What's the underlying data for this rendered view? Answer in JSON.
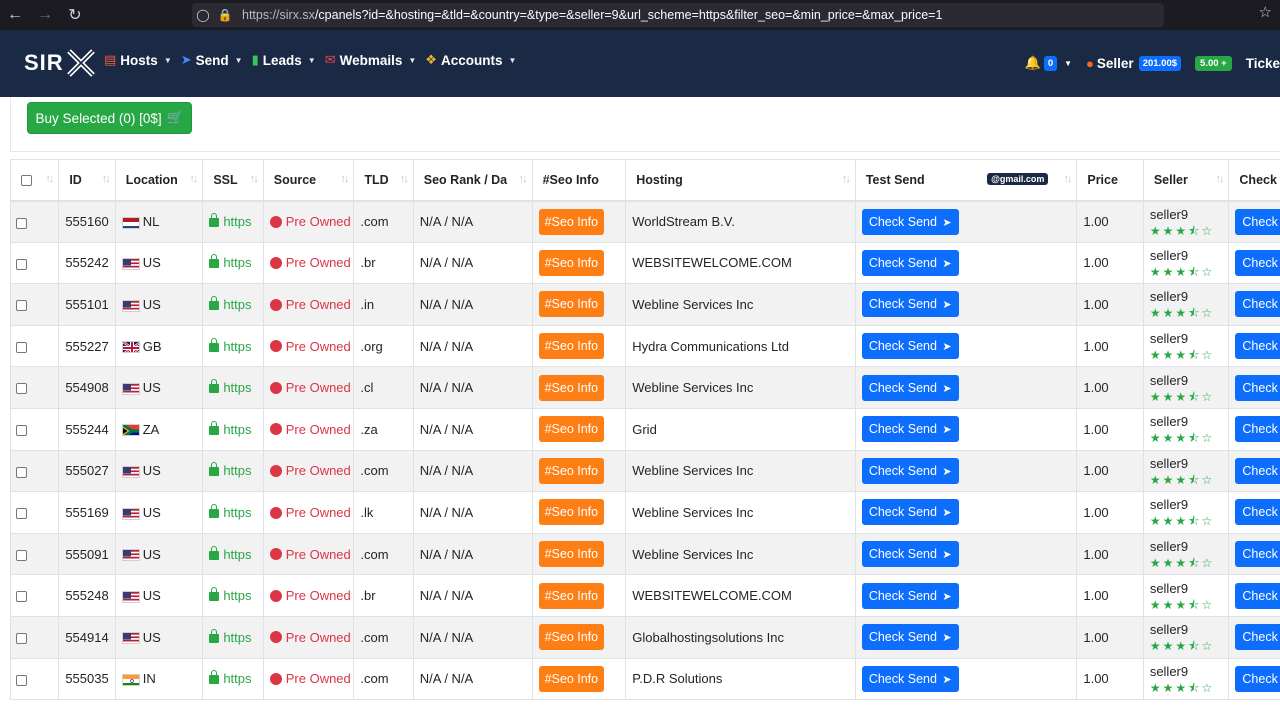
{
  "browser": {
    "url_host": "https://sirx.sx",
    "url_path": "/cpanels?id=&hosting=&tld=&country=&type=&seller=9&url_scheme=https&filter_seo=&min_price=&max_price=1"
  },
  "header": {
    "logo": "SIR",
    "menu": [
      {
        "label": "Hosts",
        "icon": "server-icon",
        "color": "#e8623a"
      },
      {
        "label": "Send",
        "icon": "paper-plane-icon",
        "color": "#3d8bfd"
      },
      {
        "label": "Leads",
        "icon": "file-icon",
        "color": "#3cc35e"
      },
      {
        "label": "Webmails",
        "icon": "envelope-icon",
        "color": "#e04a4a"
      },
      {
        "label": "Accounts",
        "icon": "users-icon",
        "color": "#f0b429"
      }
    ],
    "notifications_count": "0",
    "seller_label": "Seller",
    "seller_balance": "201.00$",
    "balance_add": "5.00 +",
    "tickets_label": "Ticke"
  },
  "buy_button": "Buy Selected (0) [0$]",
  "table": {
    "columns": [
      "ID",
      "Location",
      "SSL",
      "Source",
      "TLD",
      "Seo Rank / Da",
      "#Seo Info",
      "Hosting",
      "Test Send",
      "Price",
      "Seller",
      "Check"
    ],
    "gmail_badge": "@gmail.com",
    "seo_button": "#Seo Info",
    "check_send_button": "Check Send",
    "check_button": "Check",
    "rows": [
      {
        "id": "555160",
        "country": "NL",
        "ssl": "https",
        "source": "Pre Owned",
        "tld": ".com",
        "seo": "N/A / N/A",
        "hosting": "WorldStream B.V.",
        "price": "1.00",
        "seller": "seller9"
      },
      {
        "id": "555242",
        "country": "US",
        "ssl": "https",
        "source": "Pre Owned",
        "tld": ".br",
        "seo": "N/A / N/A",
        "hosting": "WEBSITEWELCOME.COM",
        "price": "1.00",
        "seller": "seller9"
      },
      {
        "id": "555101",
        "country": "US",
        "ssl": "https",
        "source": "Pre Owned",
        "tld": ".in",
        "seo": "N/A / N/A",
        "hosting": "Webline Services Inc",
        "price": "1.00",
        "seller": "seller9"
      },
      {
        "id": "555227",
        "country": "GB",
        "ssl": "https",
        "source": "Pre Owned",
        "tld": ".org",
        "seo": "N/A / N/A",
        "hosting": "Hydra Communications Ltd",
        "price": "1.00",
        "seller": "seller9"
      },
      {
        "id": "554908",
        "country": "US",
        "ssl": "https",
        "source": "Pre Owned",
        "tld": ".cl",
        "seo": "N/A / N/A",
        "hosting": "Webline Services Inc",
        "price": "1.00",
        "seller": "seller9"
      },
      {
        "id": "555244",
        "country": "ZA",
        "ssl": "https",
        "source": "Pre Owned",
        "tld": ".za",
        "seo": "N/A / N/A",
        "hosting": "Grid",
        "price": "1.00",
        "seller": "seller9"
      },
      {
        "id": "555027",
        "country": "US",
        "ssl": "https",
        "source": "Pre Owned",
        "tld": ".com",
        "seo": "N/A / N/A",
        "hosting": "Webline Services Inc",
        "price": "1.00",
        "seller": "seller9"
      },
      {
        "id": "555169",
        "country": "US",
        "ssl": "https",
        "source": "Pre Owned",
        "tld": ".lk",
        "seo": "N/A / N/A",
        "hosting": "Webline Services Inc",
        "price": "1.00",
        "seller": "seller9"
      },
      {
        "id": "555091",
        "country": "US",
        "ssl": "https",
        "source": "Pre Owned",
        "tld": ".com",
        "seo": "N/A / N/A",
        "hosting": "Webline Services Inc",
        "price": "1.00",
        "seller": "seller9"
      },
      {
        "id": "555248",
        "country": "US",
        "ssl": "https",
        "source": "Pre Owned",
        "tld": ".br",
        "seo": "N/A / N/A",
        "hosting": "WEBSITEWELCOME.COM",
        "price": "1.00",
        "seller": "seller9"
      },
      {
        "id": "554914",
        "country": "US",
        "ssl": "https",
        "source": "Pre Owned",
        "tld": ".com",
        "seo": "N/A / N/A",
        "hosting": "Globalhostingsolutions Inc",
        "price": "1.00",
        "seller": "seller9"
      },
      {
        "id": "555035",
        "country": "IN",
        "ssl": "https",
        "source": "Pre Owned",
        "tld": ".com",
        "seo": "N/A / N/A",
        "hosting": "P.D.R Solutions",
        "price": "1.00",
        "seller": "seller9"
      }
    ],
    "seller_rating": 3.5
  },
  "colors": {
    "header_bg": "#1a2a44",
    "buy_green": "#28a745",
    "seo_orange": "#fd7e14",
    "action_blue": "#0d6efd",
    "source_red": "#dc3545"
  }
}
